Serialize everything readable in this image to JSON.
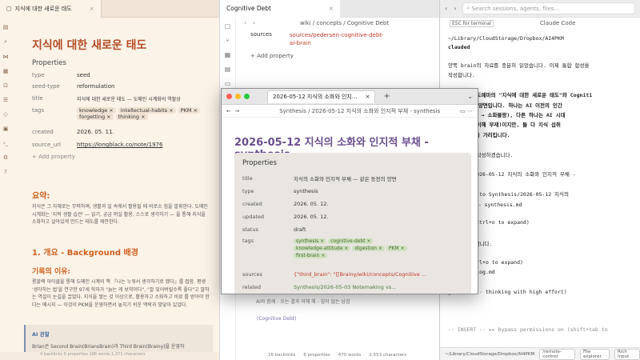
{
  "left": {
    "tab_title": "지식에 대한 새로운 태도",
    "title": "지식에 대한 새로운 태도",
    "properties_label": "Properties",
    "props": [
      {
        "key": "type",
        "value": "seed"
      },
      {
        "key": "seed-type",
        "value": "reformulation"
      },
      {
        "key": "title",
        "value": "지식에 대한 새로운 태도 — 도메인 시계화의 역할상"
      },
      {
        "key": "tags",
        "value": ""
      },
      {
        "key": "created",
        "value": "2026. 05. 11."
      },
      {
        "key": "source_url",
        "value": "https://longblack.co/note/1976"
      }
    ],
    "tags": [
      "knowledge ×",
      "intellectual-habits ×",
      "PKM ×",
      "forgetting ×",
      "thinking ×"
    ],
    "add_property": "+ Add property",
    "h_summary": "요약:",
    "p_summary": "지식은 그 자체로는 무력하며, 생활과 일 속에서 활용될 때 비로소 힘을 발휘한다. 도메인 시계화는 '지적 생활 습관' — 읽기, 궁금 머실 활용, 스스로 생각하기 — 을 통해 지식을 소화하고 살아있게 만드는 태도를 제안한다.",
    "h_overview": "1. 개요 - Background 배경",
    "h_reason": "기록의 이유:",
    "p_reason": "롱블랙 아티클을 통해 도메인 시계의 책 『나는 누워서 생각하기로 했다』를 접함. 평생 '생각하는 법'을 연구한 97세 학자가 \"늙는 게 보약이다\", \"잘 잊어버릴수록 좋다\"고 말하는 역설이 눈길을 끌었다. 지식을 쌓는 것 이상으로, 활용하고 소화하고 비료 를 받아야 한다는 메시지 — 이것이 PKM을 운영하면서 놓치기 쉬운 맥락과 맞닿아 있었다.",
    "callout_title": "AI 관찰",
    "callout_body": "Brian은 Second Brain(BriansBrain)과 Third Brain(Brainy)을 운영하",
    "status": "4 backlinks   6 properties   186 words   1,371 characters"
  },
  "mid": {
    "tab_title": "Cognitive Debt",
    "breadcrumb": "wiki / concepts / Cognitive Debt",
    "sources_key": "sources",
    "sources_value": "sources/pedersen-cognitive-debt-ai-brain",
    "add_property": "+ Add property",
    "bottom_line1": "AI와 함께 - 오는 결과 이해 해 - 깊이 없는 남김",
    "bottom_line2": "(Cognitive Debt)",
    "status": [
      "16 backlinks",
      "6 properties",
      "470 words",
      "2,553 characters"
    ]
  },
  "right": {
    "search_placeholder": "Search sessions, agents, files...",
    "tab1": "ESC for terminal",
    "tab2": "Claude Code",
    "path": "~/Library/CloudStorage/Dropbox/AI4PKM",
    "prompt": "clauded",
    "lines": [
      "양쪽 brain의 자료를 충분히 읽었습니다. 이제 통합 합성을",
      "작성합니다.",
      "",
      "핵심 발견: 도메마의 \"지식에 대한 새로운 태도\"와 Cogniti",
      "같은 동전의 양면입니다. 하나는 AI 이전의 인간",
      "채(과잉 수집 → 소화불량), 다른 하나는 AI 시대",
      "아웃소싱 → 이해 부재)이지만, 둘 다 지식 섭취",
      "사이의 단절을 가리킵니다.",
      "",
      "s 페이지를 작성하겠습니다.",
      "",
      "nthesis/2026-05-12 지식의 소화와 인지적 부채 -",
      "thesis.md)",
      " 179 lines to Synthesis/2026-05-12 지식의",
      " 인지적 부채 - synthesis.md",
      "",
      "9 lines (ctrl+o to expand)",
      "",
      ".md에 기록합니다.",
      "",
      " file… (ctrl+o to expand)",
      "ppy/wiki/log.md",
      "",
      "g… (5m 4s · thinking with high effort)"
    ],
    "insert_line": "-- INSERT --  ▸▸ bypass permissions on (shift+tab to",
    "footer": [
      "~/Library/CloudStorage/Dropbox/AI4PKM",
      "/remote-control",
      "File explorer",
      "Rich Input"
    ]
  },
  "float": {
    "tab_title": "2026-05-12 지식의 소화와 인지...",
    "breadcrumb": "Synthesis / 2026-05-12 지식의 소화와 인지적 부채 - synthesis",
    "title": "2026-05-12 지식의 소화와 인지적 부채 - synthesis",
    "properties_label": "Properties",
    "props": [
      {
        "key": "title",
        "value": "지식의 소화와 인지적 부채 — 같은 동전의 양면"
      },
      {
        "key": "type",
        "value": "synthesis"
      },
      {
        "key": "created",
        "value": "2026. 05. 12."
      },
      {
        "key": "updated",
        "value": "2026. 05. 12."
      },
      {
        "key": "status",
        "value": "draft"
      }
    ],
    "tags_key": "tags",
    "tags": [
      "synthesis ×",
      "cognitive-debt ×",
      "knowledge-attitude ×",
      "digestion ×",
      "PKM ×",
      "first-brain ×"
    ],
    "sources_key": "sources",
    "sources_value": "{\"third_brain\": \"[[Brainy/wiki/concepts/Cognitive ...",
    "related_key": "related",
    "related_value": "Synthesis/2026-05-03 Notemaking vs..."
  },
  "colors": {
    "accent_left": "#b44d27",
    "accent_float": "#6b4e8f",
    "tag_green": "#4a6a2c"
  }
}
